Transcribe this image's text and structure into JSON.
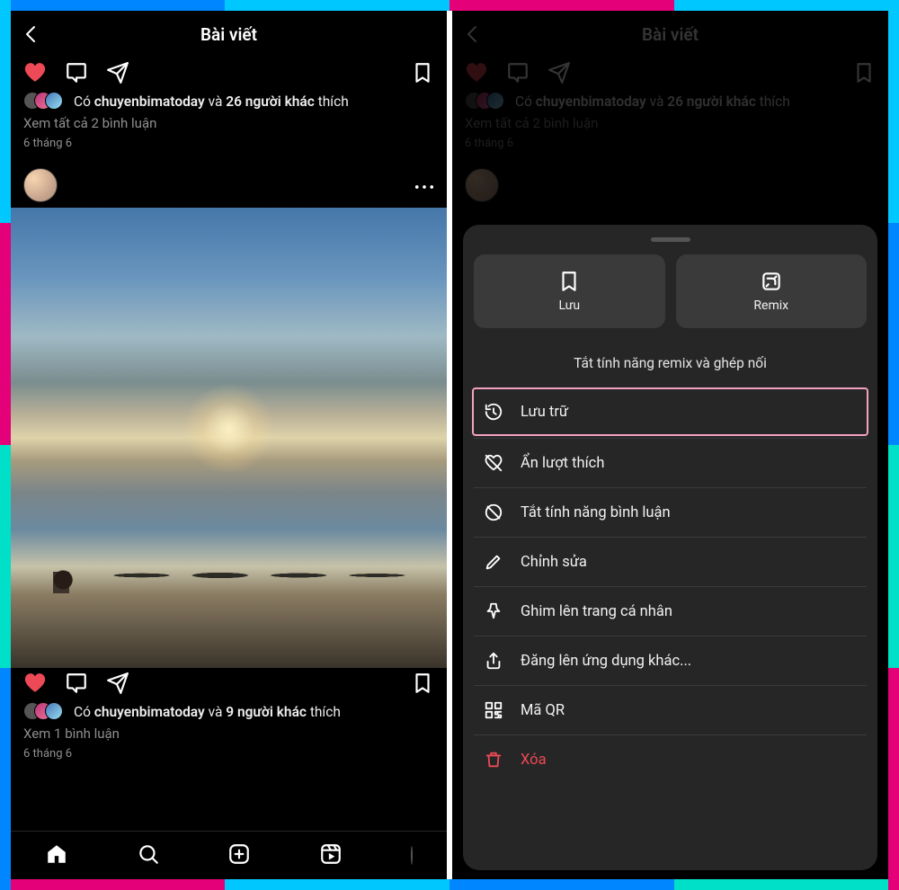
{
  "colors": {
    "accent_like": "#ED4956",
    "sheet_bg": "#262626",
    "highlight_border": "#F2A2C1",
    "arrow": "#FF1E2D"
  },
  "left": {
    "header_title": "Bài viết",
    "top_post": {
      "likes_prefix": "Có ",
      "liked_by_user": "chuyenbimatoday",
      "likes_middle": " và ",
      "others_count_text": "26 người khác",
      "likes_suffix": " thích",
      "view_comments": "Xem tất cả 2 bình luận",
      "date": "6 tháng 6"
    },
    "bottom_post": {
      "likes_prefix": "Có ",
      "liked_by_user": "chuyenbimatoday",
      "likes_middle": " và ",
      "others_count_text": "9 người khác",
      "likes_suffix": " thích",
      "view_comments": "Xem 1 bình luận",
      "date": "6 tháng 6"
    }
  },
  "right": {
    "header_title": "Bài viết",
    "top_post": {
      "likes_prefix": "Có ",
      "liked_by_user": "chuyenbimatoday",
      "likes_middle": " và ",
      "others_count_text": "26 người khác",
      "likes_suffix": " thích",
      "view_comments": "Xem tất cả 2 bình luận",
      "date": "6 tháng 6"
    },
    "sheet": {
      "save_label": "Lưu",
      "remix_label": "Remix",
      "section_title": "Tắt tính năng remix và ghép nối",
      "items": {
        "archive": "Lưu trữ",
        "hide_likes": "Ẩn lượt thích",
        "turn_off_comments": "Tắt tính năng bình luận",
        "edit": "Chỉnh sửa",
        "pin_profile": "Ghim lên trang cá nhân",
        "post_other_apps": "Đăng lên ứng dụng khác...",
        "qr_code": "Mã QR",
        "delete": "Xóa"
      }
    }
  }
}
